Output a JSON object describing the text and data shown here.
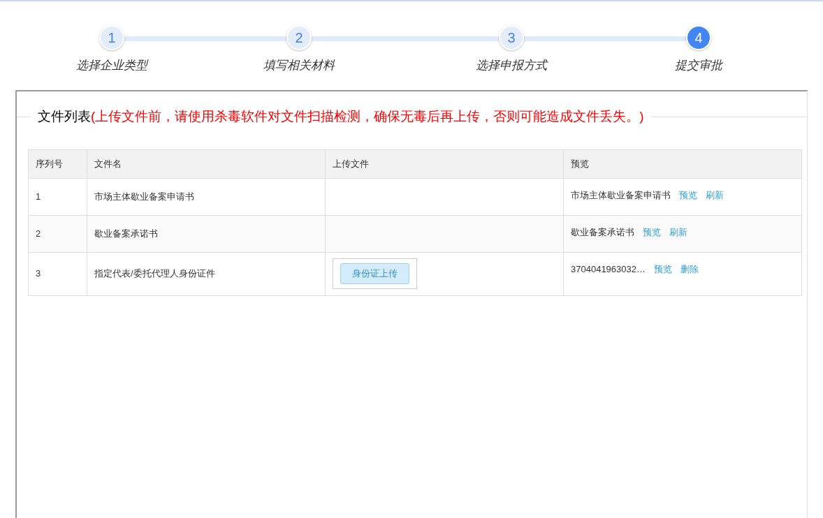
{
  "steps": [
    {
      "number": "1",
      "label": "选择企业类型",
      "selected": false
    },
    {
      "number": "2",
      "label": "填写相关材料",
      "selected": false
    },
    {
      "number": "3",
      "label": "选择申报方式",
      "selected": false
    },
    {
      "number": "4",
      "label": "提交审批",
      "selected": true
    }
  ],
  "file_list": {
    "title": "文件列表",
    "warning": "(上传文件前，请使用杀毒软件对文件扫描检测，确保无毒后再上传，否则可能造成文件丢失。)",
    "columns": [
      "序列号",
      "文件名",
      "上传文件",
      "预览"
    ],
    "rows": [
      {
        "index": "1",
        "name": "市场主体歇业备案申请书",
        "preview": "市场主体歇业备案申请书",
        "actions": [
          "预览",
          "刷新"
        ]
      },
      {
        "index": "2",
        "name": "歇业备案承诺书",
        "preview": "歇业备案承诺书",
        "actions": [
          "预览",
          "刷新"
        ]
      },
      {
        "index": "3",
        "name": "指定代表/委托代理人身份证件",
        "upload_button": "身份证上传",
        "preview": "3704041963032…",
        "actions": [
          "预览",
          "删除"
        ]
      }
    ]
  }
}
